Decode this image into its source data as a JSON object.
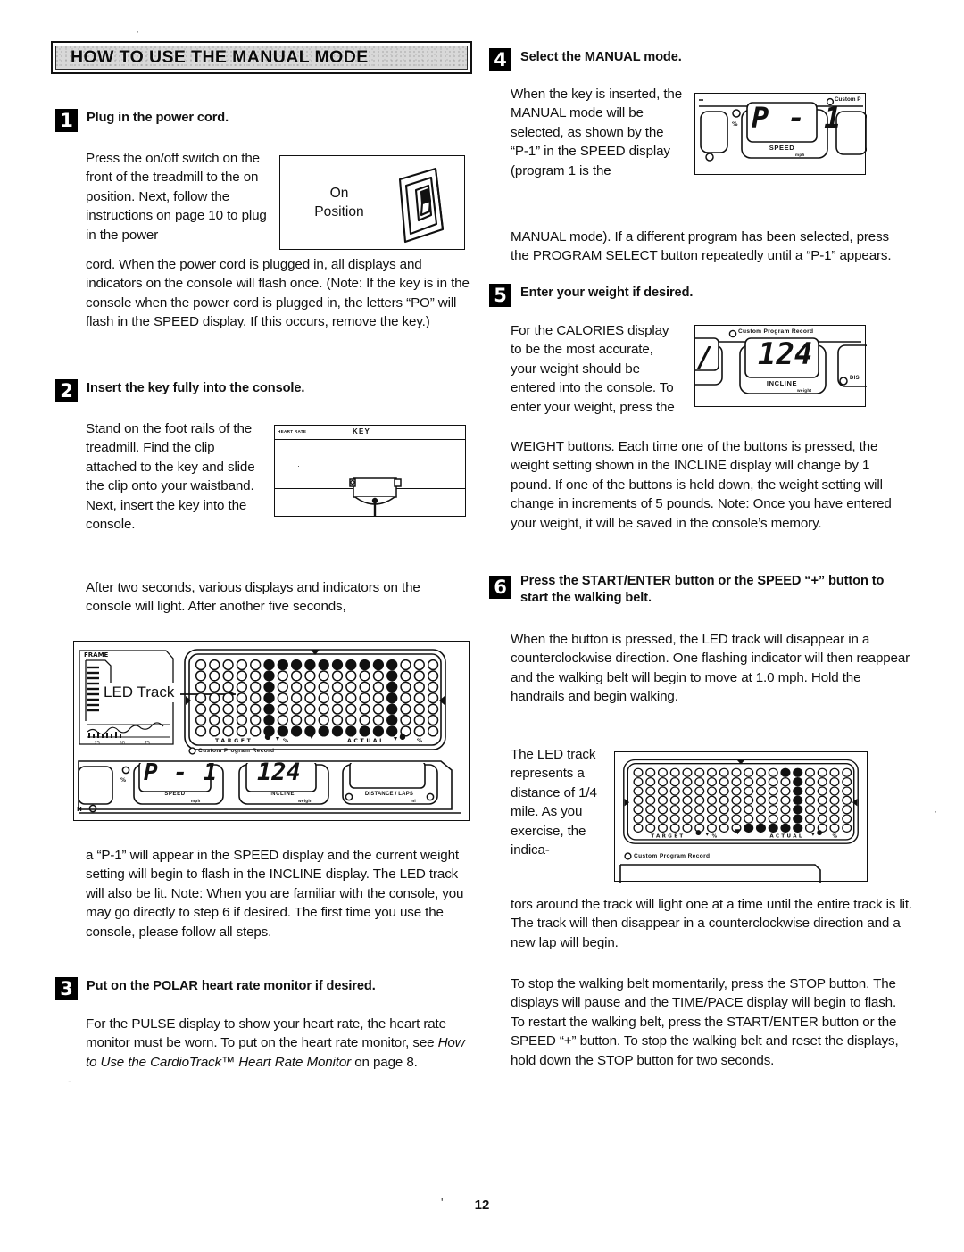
{
  "document": {
    "page_number": "12",
    "banner_title": "HOW TO USE THE MANUAL MODE"
  },
  "steps": [
    {
      "number": "1",
      "heading": "Plug in the power cord.",
      "body_wrapped": "Press the on/off switch on the front of the treadmill to the on position. Next, follow the instructions on page 10 to plug in the power",
      "body_full": "cord. When the power cord is plugged in, all displays and indicators on the console will flash once. (Note: If the key is in the console when the power cord is plugged in, the letters “PO” will flash in the SPEED display. If this occurs, remove the key.)"
    },
    {
      "number": "2",
      "heading": "Insert the key fully into the console.",
      "body_wrapped": "Stand on the foot rails of the treadmill. Find the clip attached to the key and slide the clip onto your waistband. Next, insert the key into the console.",
      "body_after": "After two seconds, various displays and indicators on the console will light. After another five seconds,",
      "body_continued": "a “P-1” will appear in the SPEED display and the current weight setting will begin to flash in the INCLINE display. The LED track will also be lit. Note: When you are familiar with the console, you may go directly to step 6 if desired. The first time you use the console, please follow all steps."
    },
    {
      "number": "3",
      "heading": "Put on the POLAR heart rate monitor if desired.",
      "body_part1": "For the PULSE display to show your heart rate, the heart rate monitor must be worn. To put on the heart rate monitor, see ",
      "body_italic": "How to Use the CardioTrack™ Heart Rate Monitor",
      "body_part2": " on page 8."
    },
    {
      "number": "4",
      "heading": "Select the MANUAL mode.",
      "body_wrapped": "When the key is inserted, the MANUAL mode will be selected, as shown by the “P-1” in the SPEED display (program 1 is the",
      "body_full": "MANUAL mode). If a different program has been selected, press the PROGRAM SELECT button repeatedly until a “P-1” appears."
    },
    {
      "number": "5",
      "heading": "Enter your weight if desired.",
      "body_wrapped": "For the CALORIES display to be the most accurate, your weight should be entered into the console. To enter your weight, press the",
      "body_full": "WEIGHT buttons. Each time one of the buttons is pressed, the weight setting shown in the INCLINE display will change by 1 pound. If one of the buttons is held down, the weight setting will change in increments of 5 pounds. Note: Once you have entered your weight, it will be saved in the console’s memory."
    },
    {
      "number": "6",
      "heading": "Press the START/ENTER button or the SPEED “+” button to start the walking belt.",
      "body_first": "When the button is pressed, the LED track will disappear in a counterclockwise direction. One flashing indicator will then reappear and the walking belt will begin to move at 1.0 mph. Hold the handrails and begin walking.",
      "body_wrapped": "The LED track represents a distance of 1/4 mile. As you exercise, the indica-",
      "body_full": "tors around the track will light one at a time until the entire track is lit. The track will then disappear in a counterclockwise direction and a new lap will begin.",
      "body_last": "To stop the walking belt momentarily, press the STOP button. The displays will pause and the TIME/PACE display will begin to flash. To restart the walking belt, press the START/ENTER button or the SPEED “+” button. To stop the walking belt and reset the displays, hold down the STOP button for two seconds."
    }
  ],
  "figures": {
    "on_position": {
      "label_line1": "On",
      "label_line2": "Position"
    },
    "key_insert": {
      "label_heart_rate": "HEART RATE",
      "label_key": "KEY"
    },
    "console_full": {
      "callout": "LED Track",
      "speed_value": "P - 1",
      "speed_label": "SPEED",
      "speed_units": "mph",
      "incline_value": "124",
      "incline_label": "INCLINE",
      "incline_units": "weight",
      "distance_label": "DISTANCE / LAPS",
      "distance_units": "mi",
      "custom_program": "Custom Program Record",
      "track_left_label": "TARGET",
      "track_right_label": "ACTUAL",
      "frame_label": "FRAME"
    },
    "console_speed": {
      "speed_value": "P - 1",
      "speed_label": "SPEED",
      "speed_units": "mph",
      "custom_program": "Custom P"
    },
    "console_incline": {
      "incline_value": "124",
      "incline_label": "INCLINE",
      "incline_units": "weight",
      "custom_program": "Custom Program Record",
      "distance_label": "DIS"
    },
    "console_track": {
      "custom_program": "Custom Program Record",
      "track_left_label": "TARGET",
      "track_right_label": "ACTUAL"
    }
  },
  "colors": {
    "ink": "#111111",
    "banner_fill": "#d8d8d8",
    "paper": "#ffffff"
  }
}
